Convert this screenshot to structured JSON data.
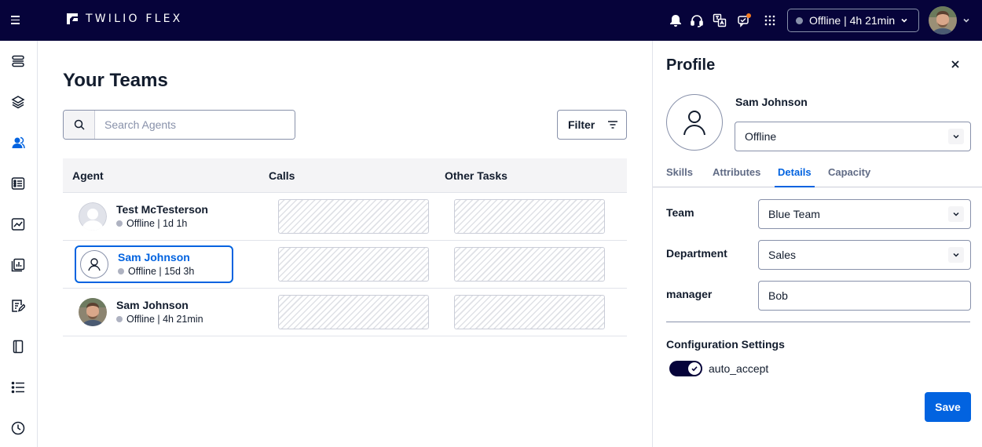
{
  "header": {
    "brand": "TWILIO FLEX",
    "status": "Offline | 4h 21min",
    "icons": [
      "bell-icon",
      "headset-icon",
      "translate-icon",
      "notification-icon",
      "apps-grid-icon",
      "chevron-down-icon"
    ]
  },
  "sidebar": {
    "icons": [
      "queues-icon",
      "layers-icon",
      "teams-icon",
      "tasks-icon",
      "insights-icon",
      "reports-icon",
      "review-icon",
      "notebook-icon",
      "list-icon",
      "history-icon"
    ]
  },
  "main": {
    "title": "Your Teams",
    "search_placeholder": "Search Agents",
    "filter_label": "Filter",
    "columns": [
      "Agent",
      "Calls",
      "Other Tasks"
    ],
    "rows": [
      {
        "name": "Test McTesterson",
        "status": "Offline | 1d 1h",
        "avatar": "default-gray"
      },
      {
        "name": "Sam Johnson",
        "status": "Offline | 15d 3h",
        "avatar": "user-outline",
        "selected": true
      },
      {
        "name": "Sam Johnson",
        "status": "Offline | 4h 21min",
        "avatar": "photo"
      }
    ]
  },
  "panel": {
    "title": "Profile",
    "name": "Sam Johnson",
    "status_value": "Offline",
    "tabs": [
      "Skills",
      "Attributes",
      "Details",
      "Capacity"
    ],
    "active_tab": "Details",
    "fields": {
      "team_label": "Team",
      "team_value": "Blue Team",
      "department_label": "Department",
      "department_value": "Sales",
      "manager_label": "manager",
      "manager_value": "Bob"
    },
    "config_title": "Configuration Settings",
    "toggle_label": "auto_accept",
    "toggle_on": true,
    "save_label": "Save"
  },
  "colors": {
    "topbar": "#06033a",
    "primary": "#0263e0",
    "text": "#121c2d",
    "border": "#8891aa"
  }
}
